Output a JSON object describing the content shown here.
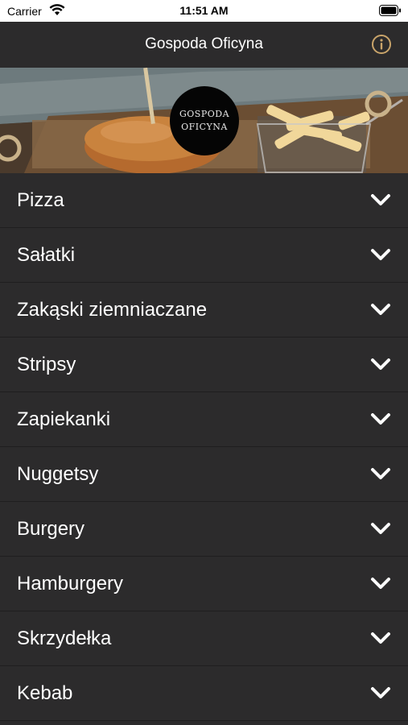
{
  "status_bar": {
    "carrier": "Carrier",
    "time": "11:51 AM"
  },
  "nav": {
    "title": "Gospoda Oficyna",
    "info_icon": "info-circle-icon",
    "info_color": "#c9a46a"
  },
  "hero": {
    "logo_line1": "GOSPODA",
    "logo_line2": "OFICYNA"
  },
  "menu": {
    "items": [
      {
        "label": "Pizza"
      },
      {
        "label": "Sałatki"
      },
      {
        "label": "Zakąski ziemniaczane"
      },
      {
        "label": "Stripsy"
      },
      {
        "label": "Zapiekanki"
      },
      {
        "label": "Nuggetsy"
      },
      {
        "label": "Burgery"
      },
      {
        "label": "Hamburgery"
      },
      {
        "label": "Skrzydełka"
      },
      {
        "label": "Kebab"
      }
    ],
    "expand_icon": "chevron-down-icon"
  }
}
